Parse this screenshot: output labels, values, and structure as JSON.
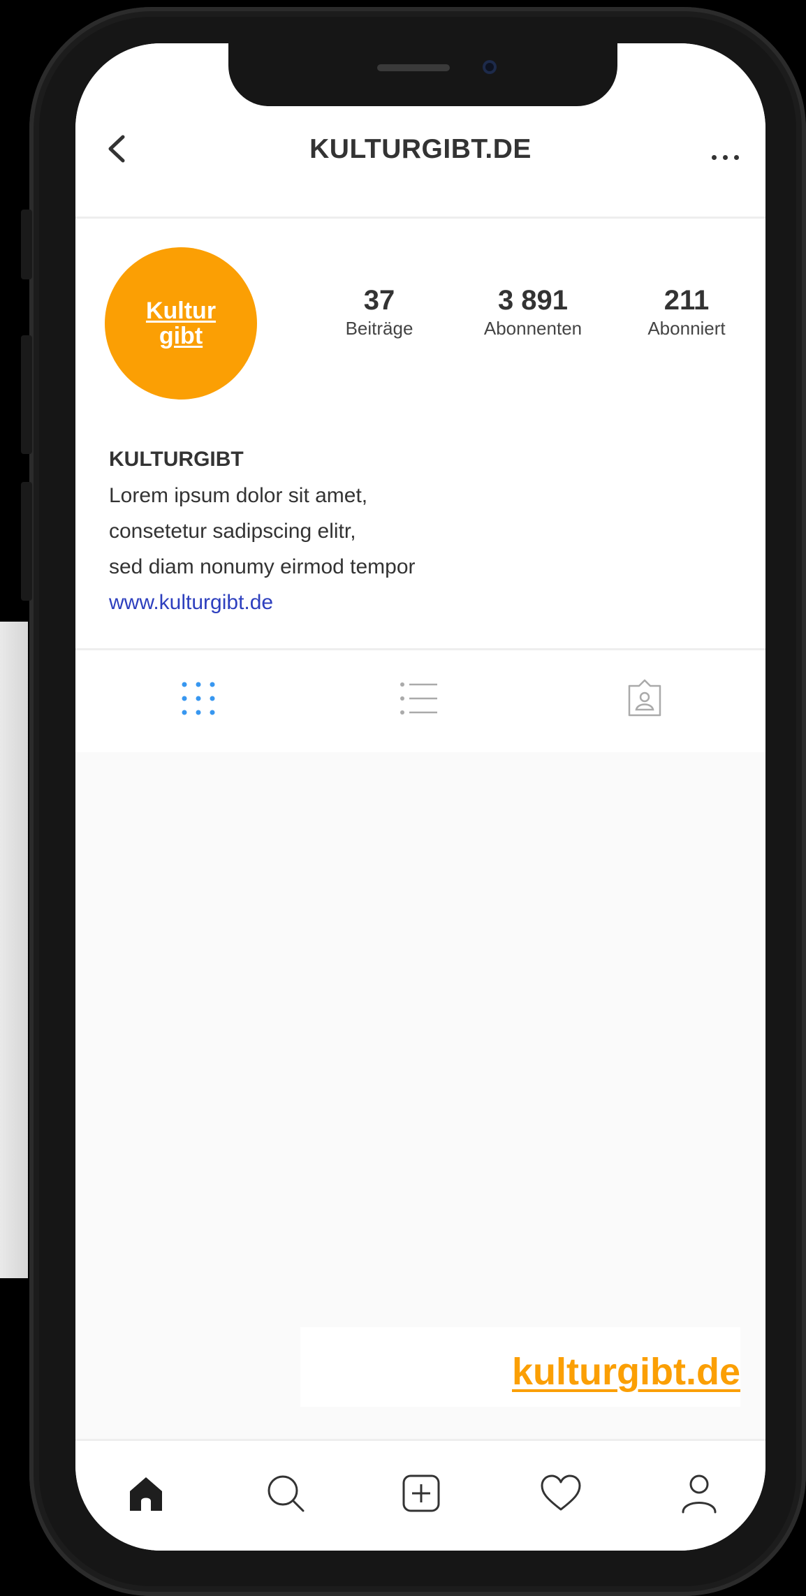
{
  "header": {
    "title": "KULTURGIBT.DE"
  },
  "profile": {
    "avatar_line1": "Kultur",
    "avatar_line2": "gibt",
    "stats": [
      {
        "value": "37",
        "label": "Beiträge"
      },
      {
        "value": "3 891",
        "label": "Abonnenten"
      },
      {
        "value": "211",
        "label": "Abonniert"
      }
    ],
    "bio": {
      "name": "KULTURGIBT",
      "lines": [
        "Lorem ipsum dolor sit amet,",
        "consetetur sadipscing elitr,",
        "sed diam nonumy eirmod tempor"
      ],
      "link": "www.kulturgibt.de"
    }
  },
  "tabs": {
    "grid_icon": "grid-icon",
    "list_icon": "list-icon",
    "tagged_icon": "tagged-icon",
    "active": "grid"
  },
  "watermark": "kulturgibt.de",
  "bottom_nav": [
    "home-icon",
    "search-icon",
    "add-post-icon",
    "heart-icon",
    "profile-icon"
  ],
  "colors": {
    "brand": "#fb9f04",
    "link": "#2d3fbe",
    "active_tab": "#3897f0",
    "text": "#333333"
  }
}
